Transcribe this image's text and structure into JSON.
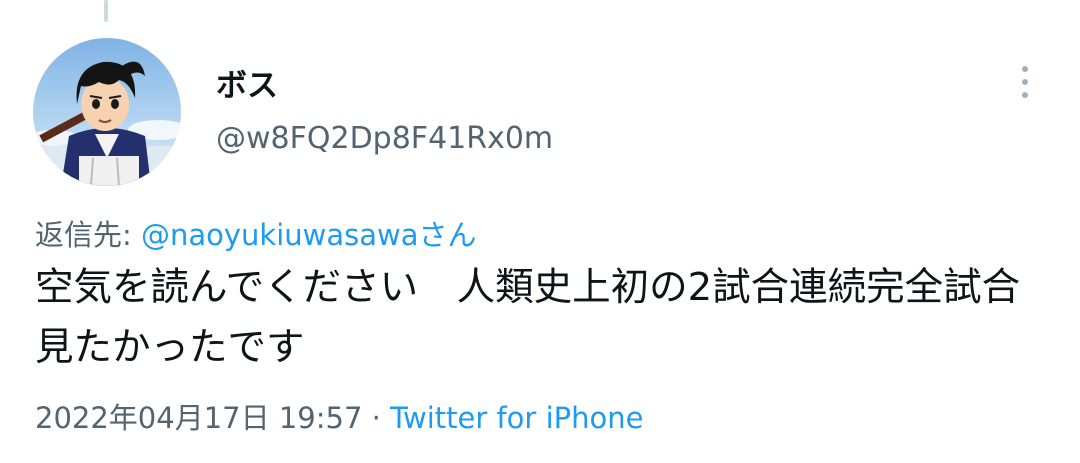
{
  "tweet": {
    "author": {
      "display_name": "ボス",
      "handle": "@w8FQ2Dp8F41Rx0m",
      "avatar": "anime-character-avatar"
    },
    "reply_prefix": "返信先: ",
    "reply_to": "@naoyukiuwasawa",
    "reply_suffix": "さん",
    "text": "空気を読んでください　人類史上初の2試合連続完全試合見たかったです",
    "timestamp": "2022年04月17日 19:57",
    "separator": " · ",
    "source": "Twitter for iPhone"
  },
  "icons": {
    "more": "more-vertical-icon"
  },
  "colors": {
    "accent": "#1d9bf0",
    "text": "#0f1419",
    "secondary": "#536471"
  }
}
